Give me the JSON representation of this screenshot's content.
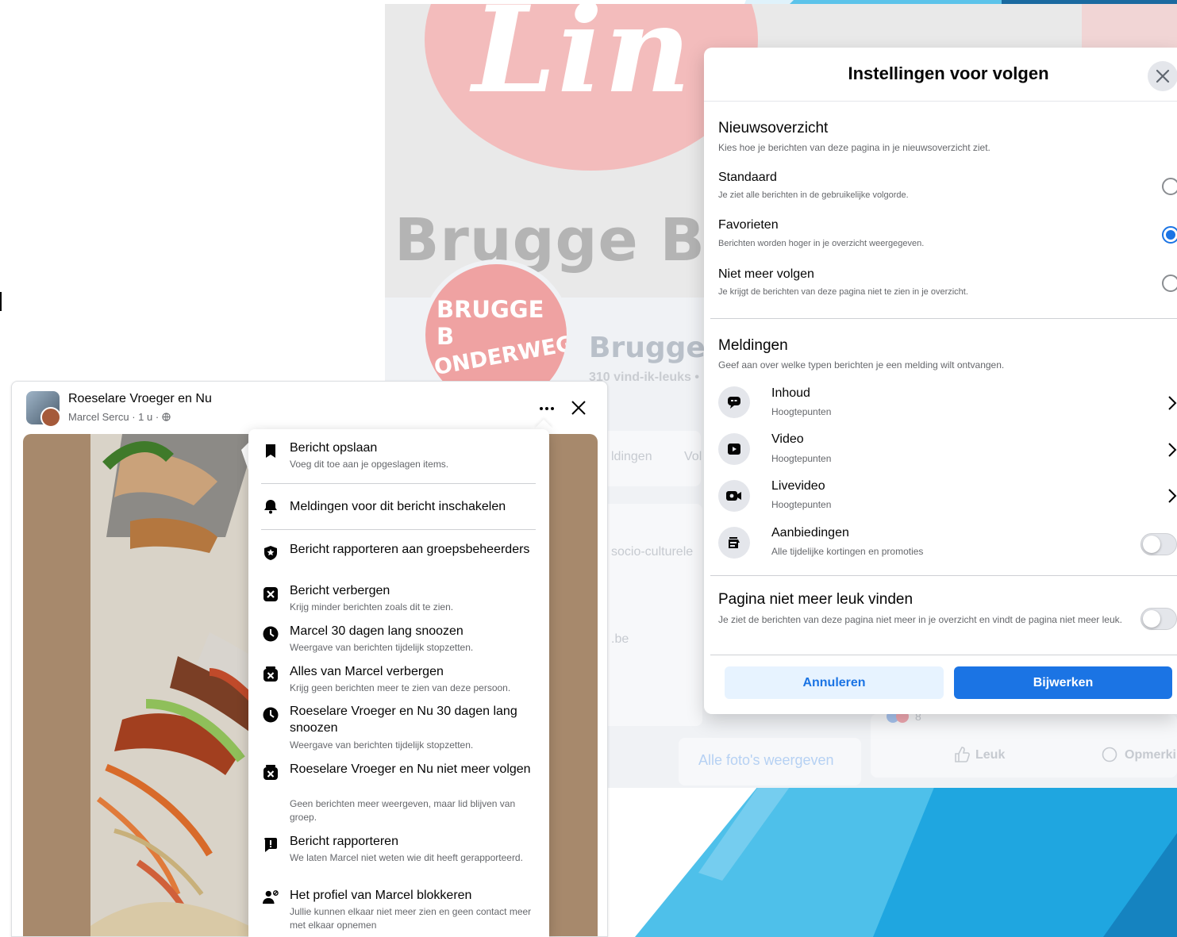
{
  "background_page": {
    "logo_text": "Lin",
    "big_title": "Brugge B",
    "profile_line1": "BRUGGE B",
    "profile_line2": "ONDERWEG",
    "page_name": "Brugge B",
    "likes_text": "310 vind-ik-leuks •",
    "tab_partial_1": "ldingen",
    "tab_partial_2": "Vol",
    "about_partial": "socio-culturele",
    "link_partial": ".be",
    "all_photos": "Alle foto's weergeven",
    "reaction_count": "8",
    "like_label": "Leuk",
    "comment_label": "Opmerki"
  },
  "dialog": {
    "title": "Instellingen voor volgen",
    "newsfeed": {
      "heading": "Nieuwsoverzicht",
      "subheading": "Kies hoe je berichten van deze pagina in je nieuwsoverzicht ziet.",
      "options": [
        {
          "title": "Standaard",
          "sub": "Je ziet alle berichten in de gebruikelijke volgorde.",
          "selected": false
        },
        {
          "title": "Favorieten",
          "sub": "Berichten worden hoger in je overzicht weergegeven.",
          "selected": true
        },
        {
          "title": "Niet meer volgen",
          "sub": "Je krijgt de berichten van deze pagina niet te zien in je overzicht.",
          "selected": false
        }
      ]
    },
    "notifications": {
      "heading": "Meldingen",
      "subheading": "Geef aan over welke typen berichten je een melding wilt ontvangen.",
      "items": [
        {
          "title": "Inhoud",
          "sub": "Hoogtepunten",
          "icon": "speech-bubble-icon"
        },
        {
          "title": "Video",
          "sub": "Hoogtepunten",
          "icon": "video-play-icon"
        },
        {
          "title": "Livevideo",
          "sub": "Hoogtepunten",
          "icon": "live-video-camera-icon"
        },
        {
          "title": "Aanbiedingen",
          "sub": "Alle tijdelijke kortingen en promoties",
          "icon": "offers-icon",
          "toggle": false
        }
      ]
    },
    "unlike": {
      "heading": "Pagina niet meer leuk vinden",
      "subheading": "Je ziet de berichten van deze pagina niet meer in je overzicht en vindt de pagina niet meer leuk.",
      "toggle": false
    },
    "cancel_label": "Annuleren",
    "update_label": "Bijwerken"
  },
  "post": {
    "group_name": "Roeselare Vroeger en Nu",
    "meta": "Marcel Sercu · 1 u · ",
    "globe_icon": "globe-icon"
  },
  "menu": {
    "items": [
      {
        "title": "Bericht opslaan",
        "sub": "Voeg dit toe aan je opgeslagen items.",
        "icon": "bookmark-icon"
      },
      {
        "title": "Meldingen voor dit bericht inschakelen",
        "sub": "",
        "icon": "bell-icon"
      },
      {
        "title": "Bericht rapporteren aan groepsbeheerders",
        "sub": "",
        "icon": "shield-star-icon"
      },
      {
        "title": "Bericht verbergen",
        "sub": "Krijg minder berichten zoals dit te zien.",
        "icon": "hide-x-icon"
      },
      {
        "title": "Marcel 30 dagen lang snoozen",
        "sub": "Weergave van berichten tijdelijk stopzetten.",
        "icon": "clock-icon"
      },
      {
        "title": "Alles van Marcel verbergen",
        "sub": "Krijg geen berichten meer te zien van deze persoon.",
        "icon": "unfollow-icon"
      },
      {
        "title": "Roeselare Vroeger en Nu 30 dagen lang snoozen",
        "sub": "Weergave van berichten tijdelijk stopzetten.",
        "icon": "clock-icon"
      },
      {
        "title": "Roeselare Vroeger en Nu niet meer volgen",
        "sub": "Geen berichten meer weergeven, maar lid blijven van groep.",
        "icon": "unfollow-icon"
      },
      {
        "title": "Bericht rapporteren",
        "sub": "We laten Marcel niet weten wie dit heeft gerapporteerd.",
        "icon": "report-icon"
      },
      {
        "title": "Het profiel van Marcel blokkeren",
        "sub": "Jullie kunnen elkaar niet meer zien en geen contact meer met elkaar opnemen",
        "icon": "block-user-icon"
      }
    ]
  },
  "colors": {
    "accent": "#1b74e4",
    "slide_blue": "#1fa6e0",
    "photo_frame": "#a7896c"
  }
}
